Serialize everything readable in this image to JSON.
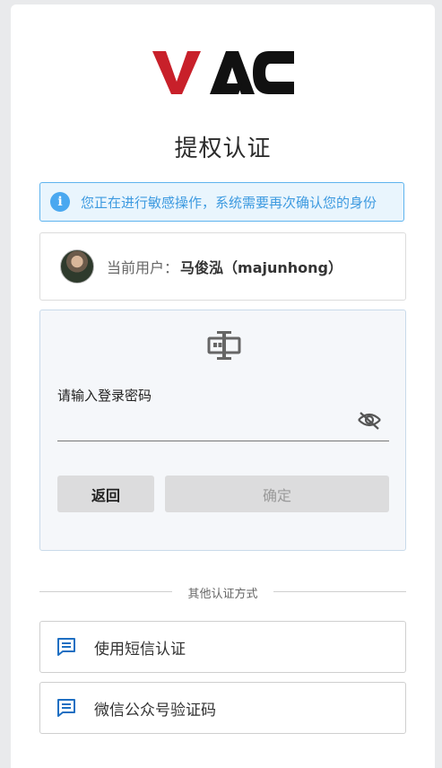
{
  "logo": {
    "text": "VAC",
    "accent": "#c8202a",
    "dark": "#111111"
  },
  "page": {
    "title": "提权认证"
  },
  "notice": {
    "icon": "info-icon",
    "text": "您正在进行敏感操作，系统需要再次确认您的身份",
    "color": "#3d9ae0"
  },
  "user": {
    "label": "当前用户：",
    "name": "马俊泓（majunhong）"
  },
  "auth": {
    "icon": "password-auth-icon",
    "password_label": "请输入登录密码",
    "password_value": "",
    "back_label": "返回",
    "confirm_label": "确定"
  },
  "other": {
    "divider_text": "其他认证方式",
    "options": [
      {
        "label": "使用短信认证",
        "icon": "chat-icon"
      },
      {
        "label": "微信公众号验证码",
        "icon": "chat-icon"
      }
    ],
    "icon_color": "#1e6fc2"
  }
}
